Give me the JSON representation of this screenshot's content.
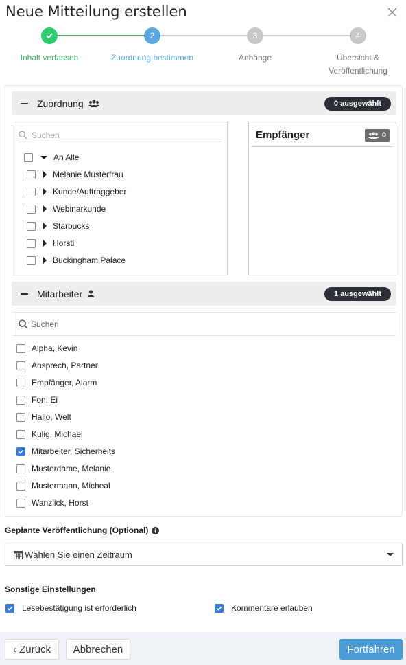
{
  "dialog": {
    "title": "Neue Mitteilung erstellen",
    "close_icon": "close-icon"
  },
  "stepper": {
    "steps": [
      {
        "number": "✓",
        "label": "Inhalt verfassen",
        "state": "done"
      },
      {
        "number": "2",
        "label": "Zuordnung bestimmen",
        "state": "active"
      },
      {
        "number": "3",
        "label": "Anhänge",
        "state": "todo"
      },
      {
        "number": "4",
        "label": "Übersicht & Veröffentlichung",
        "state": "todo"
      }
    ]
  },
  "assignment": {
    "title": "Zuordnung",
    "icon": "group-icon",
    "badge": "0 ausgewählt",
    "search_placeholder": "Suchen",
    "root": "An Alle",
    "items": [
      "Melanie Musterfrau",
      "Kunde/Auftraggeber",
      "Webinarkunde",
      "Starbucks",
      "Horsti",
      "Buckingham Palace"
    ],
    "recipients": {
      "title": "Empfänger",
      "count": "0",
      "icon": "group-icon"
    }
  },
  "employees": {
    "title": "Mitarbeiter",
    "icon": "user-icon",
    "badge": "1 ausgewählt",
    "search_placeholder": "Suchen",
    "list": [
      {
        "name": "Alpha, Kevin",
        "checked": false
      },
      {
        "name": "Ansprech, Partner",
        "checked": false
      },
      {
        "name": "Empfänger, Alarm",
        "checked": false
      },
      {
        "name": "Fon, Ei",
        "checked": false
      },
      {
        "name": "Hallo, Welt",
        "checked": false
      },
      {
        "name": "Kulig, Michael",
        "checked": false
      },
      {
        "name": "Mitarbeiter, Sicherheits",
        "checked": true
      },
      {
        "name": "Musterdame, Melanie",
        "checked": false
      },
      {
        "name": "Mustermann, Micheal",
        "checked": false
      },
      {
        "name": "Wanzlick, Horst",
        "checked": false
      }
    ]
  },
  "schedule": {
    "label": "Geplante Veröffentlichung (Optional)",
    "info_icon": "info-icon",
    "select_value": "Wählen Sie einen Zeitraum",
    "calendar_icon": "calendar-icon"
  },
  "other": {
    "label": "Sonstige Einstellungen",
    "read_receipt": "Lesebestätigung ist erforderlich",
    "read_receipt_checked": true,
    "comments": "Kommentare erlauben",
    "comments_checked": true
  },
  "footer": {
    "back": "‹ Zurück",
    "cancel": "Abbrechen",
    "continue": "Fortfahren"
  },
  "colors": {
    "done": "#2ecc71",
    "active": "#5aa9e0",
    "primary": "#4a9ad6",
    "checkbox": "#3a7bd5"
  }
}
